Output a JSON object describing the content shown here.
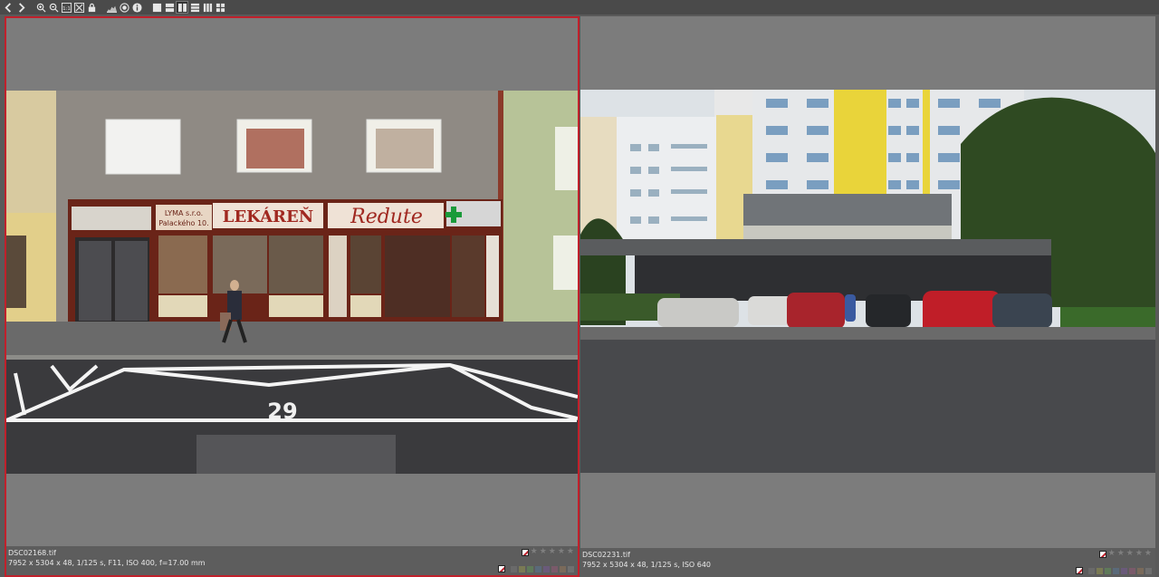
{
  "toolbar": {
    "buttons": [
      {
        "icon": "arrow-left-icon"
      },
      {
        "icon": "arrow-right-icon"
      },
      {
        "icon": "zoom-in-icon"
      },
      {
        "icon": "zoom-out-icon"
      },
      {
        "icon": "zoom-1to1-icon"
      },
      {
        "icon": "fit-screen-icon"
      },
      {
        "icon": "lock-icon"
      },
      {
        "icon": "histogram-icon"
      },
      {
        "icon": "focus-point-icon"
      },
      {
        "icon": "info-icon"
      },
      {
        "icon": "layout-single-icon"
      },
      {
        "icon": "layout-two-rows-icon"
      },
      {
        "icon": "layout-two-columns-icon",
        "active": true
      },
      {
        "icon": "layout-three-rows-icon"
      },
      {
        "icon": "layout-three-columns-icon"
      },
      {
        "icon": "layout-grid-icon"
      }
    ]
  },
  "panes": [
    {
      "selected": true,
      "filename": "DSC02168.tif",
      "exif": "7952 x 5304 x 48, 1/125 s, F11, ISO 400, f=17.00 mm",
      "photo_desc_signs": [
        "LEKÁREŇ",
        "Redute",
        "29",
        "LYMA s.r.o.",
        "Palackého 10."
      ]
    },
    {
      "selected": false,
      "filename": "DSC02231.tif",
      "exif": "7952 x 5304 x 48, 1/125 s, ISO 640"
    }
  ],
  "color_labels": [
    "#6a6a6a",
    "#7a7a54",
    "#5f7a5a",
    "#5a6a7a",
    "#6a5a7a",
    "#7a5a6a",
    "#7a6a5a",
    "#6f6f6f"
  ],
  "accent": "#c0202b"
}
